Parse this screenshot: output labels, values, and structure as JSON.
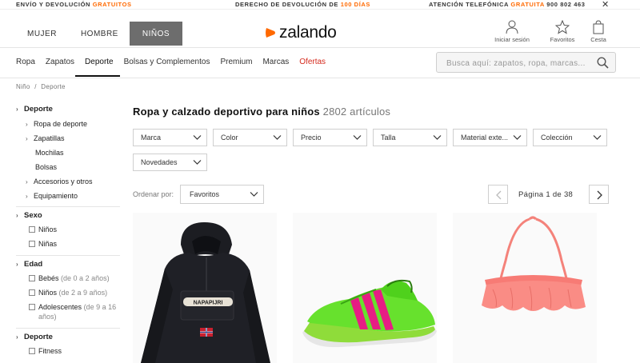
{
  "promo": {
    "left_text": "ENVÍO Y DEVOLUCIÓN",
    "left_highlight": "GRATUITOS",
    "mid_text": "DERECHO DE DEVOLUCIÓN DE",
    "mid_highlight": "100 DÍAS",
    "right_text": "ATENCIÓN TELEFÓNICA",
    "right_highlight": "GRATUITA",
    "right_phone": "900 802 463",
    "close": "✕"
  },
  "header": {
    "gender_tabs": [
      {
        "label": "MUJER"
      },
      {
        "label": "HOMBRE"
      },
      {
        "label": "NIÑOS"
      }
    ],
    "logo": "zalando",
    "icons": [
      {
        "label": "Iniciar sesión",
        "icon": "user-icon"
      },
      {
        "label": "Favoritos",
        "icon": "star-icon"
      },
      {
        "label": "Cesta",
        "icon": "bag-icon"
      }
    ]
  },
  "catnav": {
    "items": [
      "Ropa",
      "Zapatos",
      "Deporte",
      "Bolsas y Complementos",
      "Premium",
      "Marcas"
    ],
    "sale": "Ofertas"
  },
  "search": {
    "placeholder": "Busca aquí: zapatos, ropa, marcas..."
  },
  "breadcrumb": {
    "items": [
      "Niño",
      "Deporte"
    ],
    "sep": "/"
  },
  "sidebar": {
    "deporte_title": "Deporte",
    "deporte_items": [
      "Ropa de deporte",
      "Zapatillas",
      "Mochilas",
      "Bolsas",
      "Accesorios y otros",
      "Equipamiento"
    ],
    "sexo_title": "Sexo",
    "sexo_items": [
      "Niños",
      "Niñas"
    ],
    "edad_title": "Edad",
    "edad_items": [
      {
        "label": "Bebés",
        "range": "(de 0 a 2 años)"
      },
      {
        "label": "Niños",
        "range": "(de 2 a 9 años)"
      },
      {
        "label": "Adolescentes",
        "range": "(de 9 a 16",
        "range2": "años)"
      }
    ],
    "deporte2_title": "Deporte",
    "deporte2_items": [
      "Fitness"
    ]
  },
  "main": {
    "title": "Ropa y calzado deportivo para niños",
    "count": "2802 artículos",
    "filters": [
      "Marca",
      "Color",
      "Precio",
      "Talla",
      "Material exte...",
      "Colección",
      "Novedades"
    ],
    "sort_label": "Ordenar por:",
    "sort_value": "Favoritos",
    "page_text": "Página 1 de 38"
  },
  "products": [
    {
      "name": "jacket",
      "brand_patch": "NAPAPIJRI"
    },
    {
      "name": "football-shoe"
    },
    {
      "name": "bikini-top"
    }
  ],
  "colors": {
    "accent": "#ff6900",
    "sale": "#d52b1e",
    "active_tab": "#6d6d6d"
  }
}
